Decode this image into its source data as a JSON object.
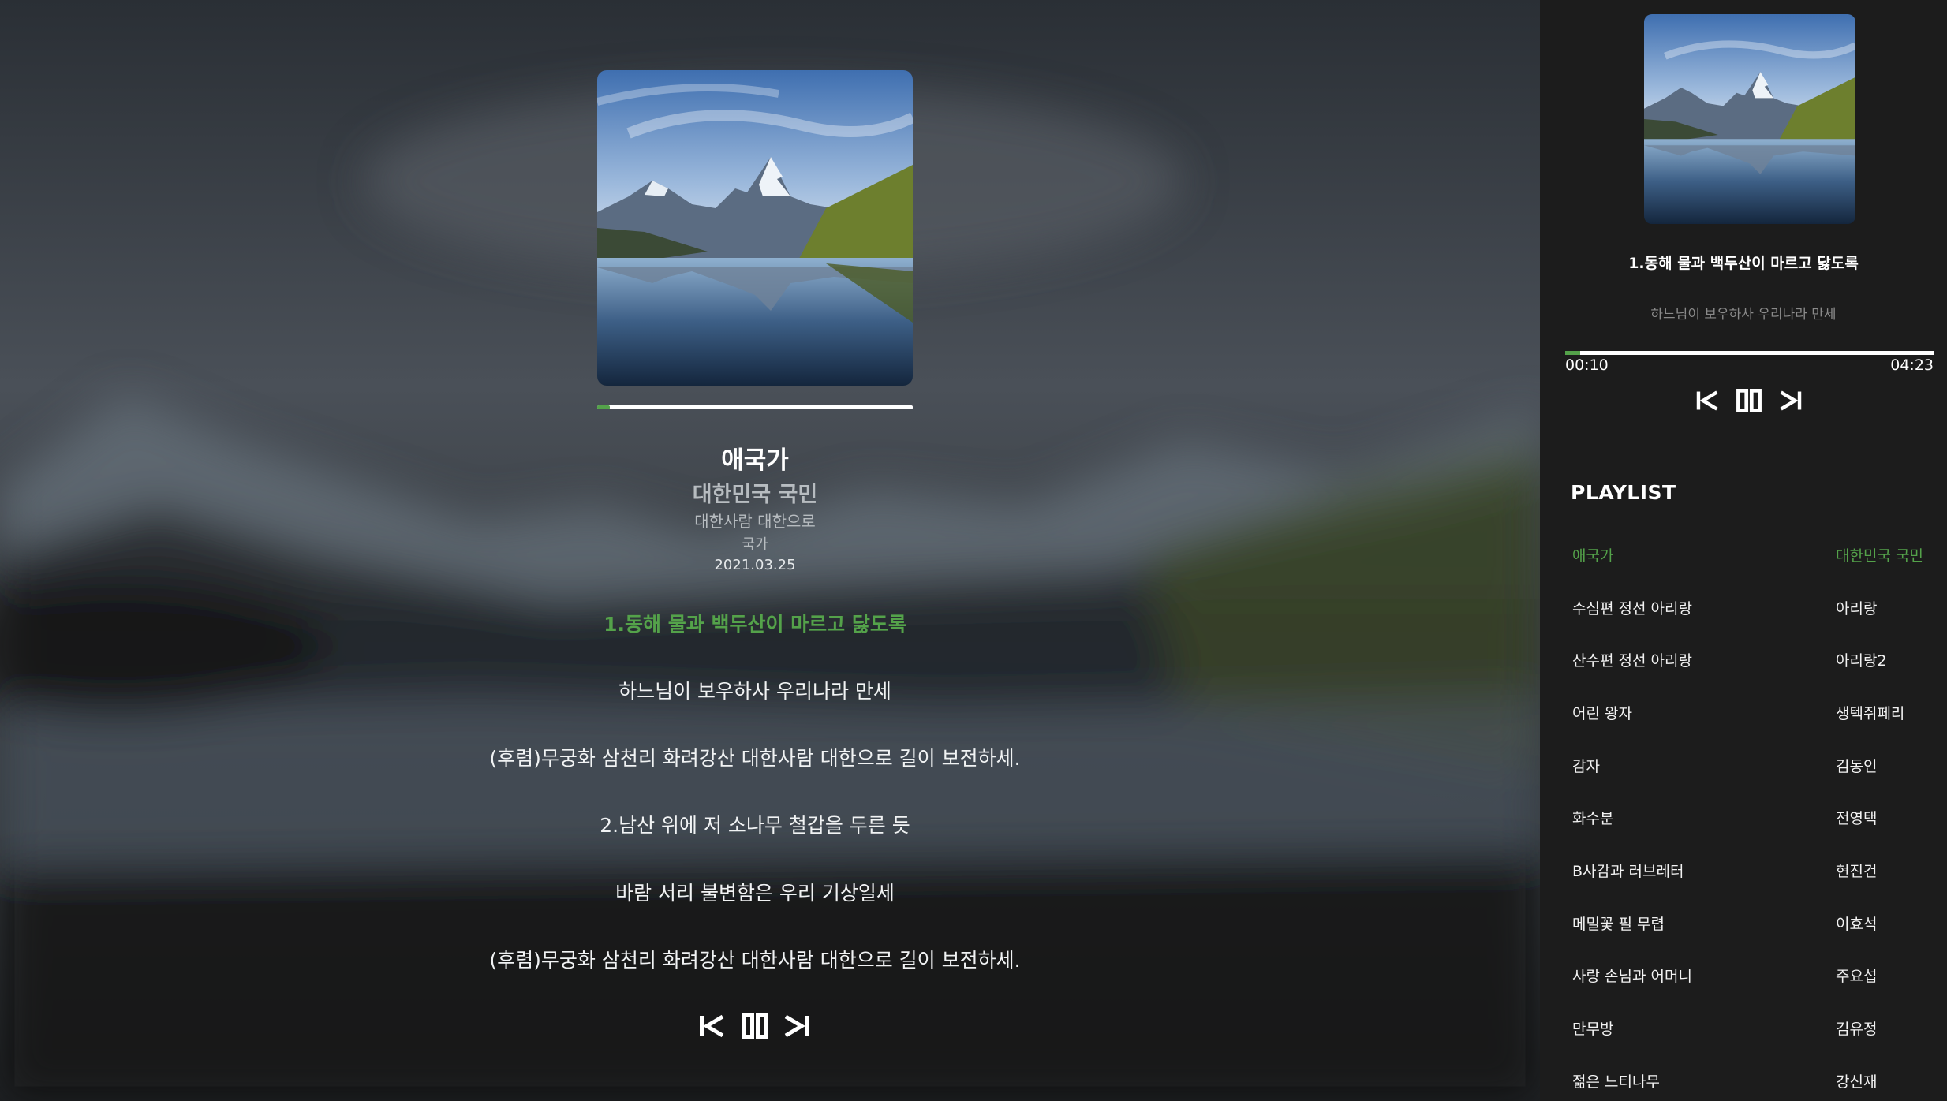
{
  "now_playing": {
    "title": "애국가",
    "artist": "대한민국 국민",
    "album": "대한사람 대한으로",
    "genre": "국가",
    "release_date": "2021.03.25",
    "progress": 0.04,
    "current_time": "00:10",
    "total_time": "04:23"
  },
  "lyrics": [
    "1.동해 물과 백두산이 마르고 닳도록",
    "하느님이 보우하사 우리나라 만세",
    "(후렴)무궁화 삼천리 화려강산 대한사람 대한으로 길이 보전하세.",
    "2.남산 위에 저 소나무 철갑을 두른 듯",
    "바람 서리 불변함은 우리 기상일세",
    "(후렴)무궁화 삼천리 화려강산 대한사람 대한으로 길이 보전하세."
  ],
  "sidebar": {
    "current_lyric": "1.동해 물과 백두산이 마르고 닳도록",
    "next_lyric": "하느님이 보우하사 우리나라 만세",
    "playlist_heading": "PLAYLIST"
  },
  "playlist": [
    {
      "title": "애국가",
      "artist": "대한민국 국민"
    },
    {
      "title": "수심편 정선 아리랑",
      "artist": "아리랑"
    },
    {
      "title": "산수편 정선 아리랑",
      "artist": "아리랑2"
    },
    {
      "title": "어린 왕자",
      "artist": "생텍쥐페리"
    },
    {
      "title": "감자",
      "artist": "김동인"
    },
    {
      "title": "화수분",
      "artist": "전영택"
    },
    {
      "title": "B사감과 러브레터",
      "artist": "현진건"
    },
    {
      "title": "메밀꽃 필 무렵",
      "artist": "이효석"
    },
    {
      "title": "사랑 손님과 어머니",
      "artist": "주요섭"
    },
    {
      "title": "만무방",
      "artist": "김유정"
    },
    {
      "title": "젊은 느티나무",
      "artist": "강신재"
    }
  ],
  "icons": {
    "previous": "skip-previous-icon",
    "pause": "pause-icon",
    "next": "skip-next-icon"
  },
  "colors": {
    "accent": "#54a24a",
    "sidebar_bg": "#1c1c1c",
    "muted_text": "#8a8a8a"
  }
}
